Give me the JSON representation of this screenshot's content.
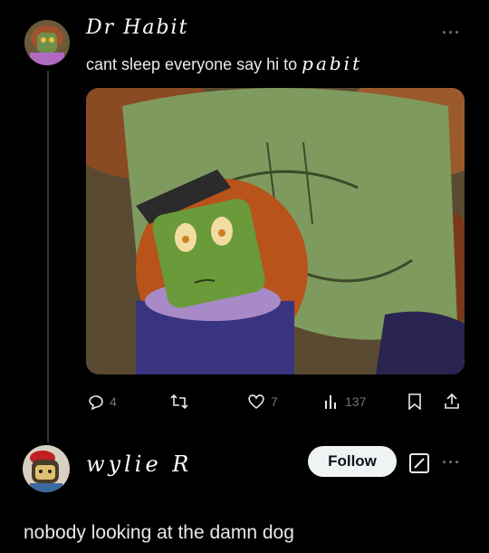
{
  "post": {
    "author_name": "Dr Habit",
    "text_main": "cant sleep everyone say hi to ",
    "text_handwritten": "pabit",
    "more_label": "···",
    "image_icon": "drawn-character-image",
    "actions": {
      "reply_count": "4",
      "retweet_count": "",
      "like_count": "7",
      "view_count": "137"
    }
  },
  "reply": {
    "author_name": "wylie R",
    "follow_label": "Follow",
    "more_label": "···",
    "text": "nobody looking at the damn dog"
  },
  "colors": {
    "background": "#000000",
    "text": "#e7e9ea",
    "muted": "#71767b",
    "follow_bg": "#eff3f4"
  }
}
